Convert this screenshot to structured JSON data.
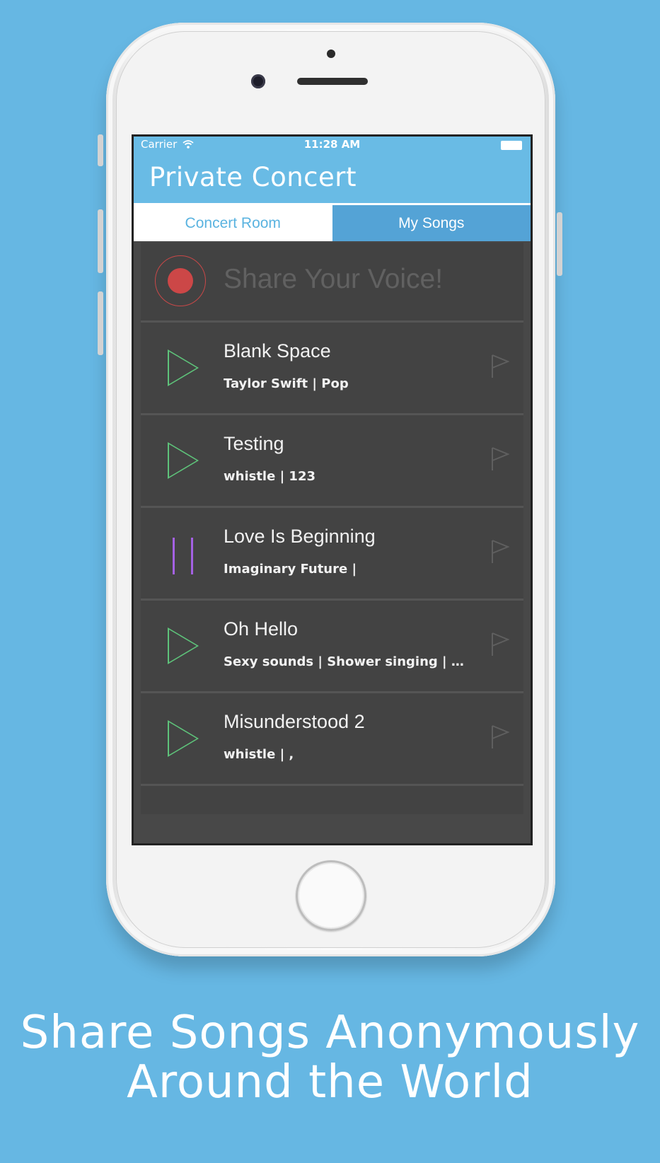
{
  "status_bar": {
    "carrier": "Carrier",
    "time": "11:28 AM"
  },
  "nav": {
    "title": "Private Concert"
  },
  "tabs": [
    {
      "label": "Concert Room",
      "active": false
    },
    {
      "label": "My Songs",
      "active": true
    }
  ],
  "record": {
    "label": "Share Your Voice!"
  },
  "songs": [
    {
      "title": "Blank Space",
      "meta": "Taylor Swift  |  Pop",
      "state": "play"
    },
    {
      "title": "Testing",
      "meta": "whistle  |  123",
      "state": "play"
    },
    {
      "title": "Love Is Beginning",
      "meta": "Imaginary Future  |",
      "state": "pause"
    },
    {
      "title": "Oh Hello",
      "meta": "Sexy sounds  |  Shower singing  |  We...",
      "state": "play"
    },
    {
      "title": "Misunderstood 2",
      "meta": "whistle  |  ,",
      "state": "play"
    }
  ],
  "caption": {
    "line1": "Share Songs Anonymously",
    "line2": "Around the World"
  },
  "colors": {
    "background": "#66b7e3",
    "navbar": "#69bbe5",
    "play": "#5ec37a",
    "pause": "#a461e3",
    "record": "#cc4747"
  },
  "icons": {
    "play": "play-icon",
    "pause": "pause-icon",
    "record": "record-icon",
    "flag": "flag-icon",
    "wifi": "wifi-icon",
    "battery": "battery-icon"
  }
}
